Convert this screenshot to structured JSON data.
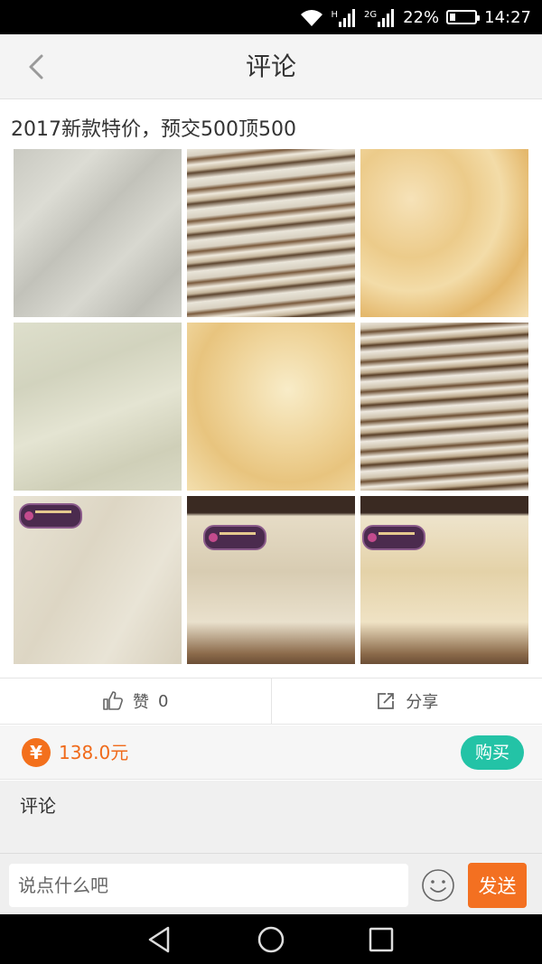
{
  "status_bar": {
    "network_h": "H",
    "network_2g": "2G",
    "battery_percent": "22%",
    "battery_level": 0.22,
    "time": "14:27",
    "icons": [
      "wifi-icon",
      "signal-icon",
      "battery-icon"
    ]
  },
  "header": {
    "title": "评论",
    "back_icon": "chevron-left-icon"
  },
  "post": {
    "title": "2017新款特价，预交500顶500",
    "images": [
      {
        "name": "tile-gray-marble"
      },
      {
        "name": "tile-brown-striped"
      },
      {
        "name": "tile-golden-marble"
      },
      {
        "name": "tile-beige-marble"
      },
      {
        "name": "tile-gold-veined"
      },
      {
        "name": "tile-brown-striped-2"
      },
      {
        "name": "tile-display-white"
      },
      {
        "name": "tile-display-cream"
      },
      {
        "name": "tile-display-gold"
      }
    ]
  },
  "actions": {
    "like_label": "赞",
    "like_count": "0",
    "share_label": "分享"
  },
  "price": {
    "currency_symbol": "¥",
    "amount": "138.0元",
    "buy_label": "购买",
    "colors": {
      "price": "#f06a1a",
      "buy": "#23c3a6"
    }
  },
  "comments": {
    "label": "评论"
  },
  "input": {
    "placeholder": "说点什么吧",
    "send_label": "发送",
    "send_color": "#f37021"
  },
  "nav": {
    "icons": [
      "back-triangle-icon",
      "home-circle-icon",
      "recents-square-icon"
    ]
  }
}
